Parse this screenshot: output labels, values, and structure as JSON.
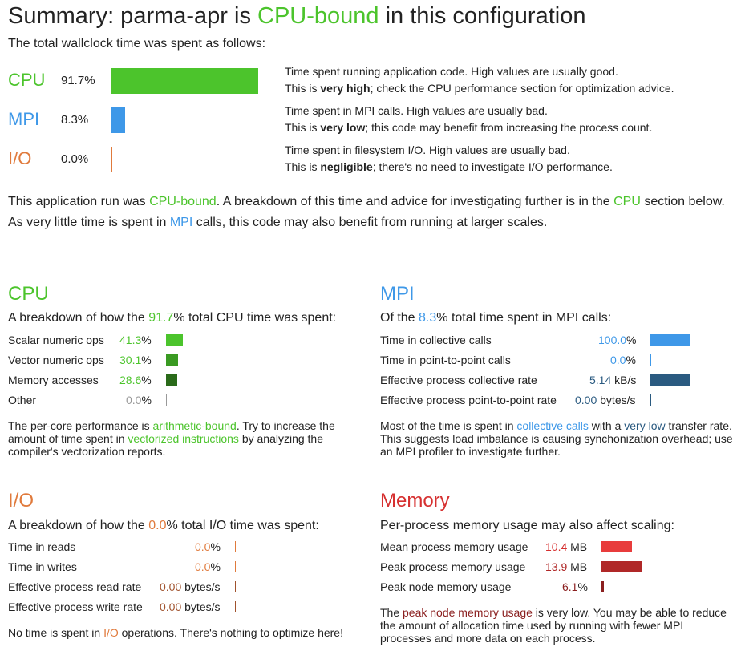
{
  "summary": {
    "title_prefix": "Summary: parma-apr is ",
    "title_highlight": "CPU-bound",
    "title_suffix": " in this configuration",
    "intro": "The total wallclock time was spent as follows:",
    "rows": [
      {
        "label": "CPU",
        "percent": "91.7%",
        "fraction": 0.917,
        "desc1": "Time spent running application code. High values are usually good.",
        "desc2_pre": "This is ",
        "desc2_bold": "very high",
        "desc2_post": "; check the CPU performance section for optimization advice."
      },
      {
        "label": "MPI",
        "percent": "8.3%",
        "fraction": 0.083,
        "desc1": "Time spent in MPI calls. High values are usually bad.",
        "desc2_pre": "This is ",
        "desc2_bold": "very low",
        "desc2_post": "; this code may benefit from increasing the process count."
      },
      {
        "label": "I/O",
        "percent": "0.0%",
        "fraction": 0.0,
        "desc1": "Time spent in filesystem I/O. High values are usually bad.",
        "desc2_pre": "This is ",
        "desc2_bold": "negligible",
        "desc2_post": "; there's no need to investigate I/O performance."
      }
    ],
    "para1": {
      "p1": "This application run was ",
      "l1": "CPU-bound",
      "p2": ". A breakdown of this time and advice for investigating further is in the ",
      "l2": "CPU",
      "p3": " section below."
    },
    "para2": {
      "p1": "As very little time is spent in ",
      "l1": "MPI",
      "p2": " calls, this code may also benefit from running at larger scales."
    }
  },
  "cpu": {
    "title": "CPU",
    "sub_pre": "A breakdown of how the ",
    "sub_val": "91.7",
    "sub_post": "% total CPU time was spent:",
    "rows": [
      {
        "label": "Scalar numeric ops",
        "value": "41.3",
        "unit": "%",
        "fraction": 0.413
      },
      {
        "label": "Vector numeric ops",
        "value": "30.1",
        "unit": "%",
        "fraction": 0.301
      },
      {
        "label": "Memory accesses",
        "value": "28.6",
        "unit": "%",
        "fraction": 0.286
      },
      {
        "label": "Other",
        "value": "0.0",
        "unit": "%",
        "fraction": 0.0
      }
    ],
    "note": {
      "p1": "The per-core performance is ",
      "l1": "arithmetic-bound",
      "p2": ". Try to increase the amount of time spent in ",
      "l2": "vectorized instructions",
      "p3": " by analyzing the compiler's vectorization reports."
    }
  },
  "mpi": {
    "title": "MPI",
    "sub_pre": "Of the ",
    "sub_val": "8.3",
    "sub_post": "% total time spent in MPI calls:",
    "rows": [
      {
        "label": "Time in collective calls",
        "value": "100.0",
        "unit": "%",
        "fraction": 1.0
      },
      {
        "label": "Time in point-to-point calls",
        "value": "0.0",
        "unit": "%",
        "fraction": 0.0
      },
      {
        "label": "Effective process collective rate",
        "value": "5.14",
        "unit": "kB/s",
        "fraction": 1.0
      },
      {
        "label": "Effective process point-to-point rate",
        "value": "0.00",
        "unit": "bytes/s",
        "fraction": 0.0
      }
    ],
    "note": {
      "p1": "Most of the time is spent in ",
      "l1": "collective calls",
      "p2": " with a ",
      "l2": "very low",
      "p3": " transfer rate. This suggests load imbalance is causing synchonization overhead; use an MPI profiler to investigate further."
    }
  },
  "io": {
    "title": "I/O",
    "sub_pre": "A breakdown of how the ",
    "sub_val": "0.0",
    "sub_post": "% total I/O time was spent:",
    "rows": [
      {
        "label": "Time in reads",
        "value": "0.0",
        "unit": "%",
        "fraction": 0.0
      },
      {
        "label": "Time in writes",
        "value": "0.0",
        "unit": "%",
        "fraction": 0.0
      },
      {
        "label": "Effective process read rate",
        "value": "0.00",
        "unit": "bytes/s",
        "fraction": 0.0
      },
      {
        "label": "Effective process write rate",
        "value": "0.00",
        "unit": "bytes/s",
        "fraction": 0.0
      }
    ],
    "note": {
      "p1": "No time is spent in ",
      "l1": "I/O",
      "p2": " operations. There's nothing to optimize here!"
    }
  },
  "memory": {
    "title": "Memory",
    "sub": "Per-process memory usage may also affect scaling:",
    "rows": [
      {
        "label": "Mean process memory usage",
        "value": "10.4",
        "unit": "MB",
        "fraction": 0.75
      },
      {
        "label": "Peak process memory usage",
        "value": "13.9",
        "unit": "MB",
        "fraction": 1.0
      },
      {
        "label": "Peak node memory usage",
        "value": "6.1",
        "unit": "%",
        "fraction": 0.061
      }
    ],
    "note": {
      "p1": "The ",
      "l1": "peak node memory usage",
      "p2": " is very low. You may be able to reduce the amount of allocation time used by running with fewer MPI processes and more data on each process."
    }
  },
  "colors": {
    "cpu": "#4cc42c",
    "cpu_mid": "#3a9a22",
    "cpu_dark": "#2a6a1a",
    "mpi": "#3e98e8",
    "mpi_dark": "#2a5a80",
    "io": "#e07a3c",
    "mem": "#e83c3c",
    "mem_mid": "#b02828",
    "mem_dark": "#8b2020"
  }
}
